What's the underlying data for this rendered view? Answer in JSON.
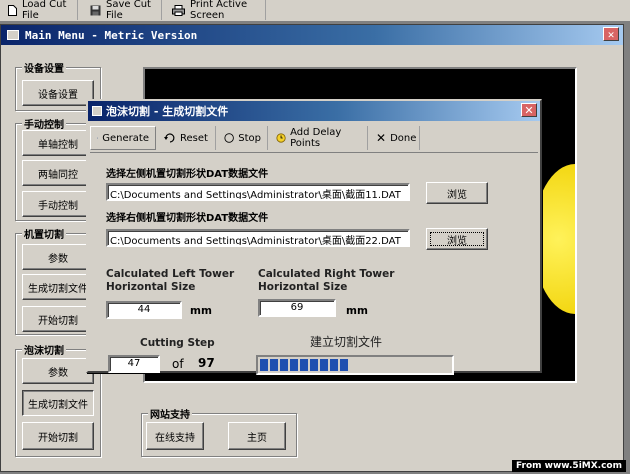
{
  "toolbar": {
    "load_cut_file": "Load Cut File",
    "save_cut_file": "Save Cut File",
    "print_active_screen": "Print Active Screen"
  },
  "main_window": {
    "title": "Main Menu -  Metric Version",
    "groups": {
      "device": {
        "title": "设备设置",
        "buttons": [
          "设备设置"
        ]
      },
      "manual": {
        "title": "手动控制",
        "buttons": [
          "单轴控制",
          "两轴同控",
          "手动控制"
        ]
      },
      "machine_cut": {
        "title": "机置切割",
        "buttons": [
          "参数",
          "生成切割文件",
          "开始切割"
        ]
      },
      "foam_cut": {
        "title": "泡沫切割",
        "buttons": [
          "参数",
          "生成切割文件",
          "开始切割"
        ]
      },
      "web_support": {
        "title": "网站支持",
        "buttons": [
          "在线支持",
          "主页"
        ]
      }
    }
  },
  "dialog": {
    "title": "泡沫切割 - 生成切割文件",
    "toolbar": {
      "generate": "Generate",
      "reset": "Reset",
      "stop": "Stop",
      "add_delay_points": "Add Delay Points",
      "done": "Done"
    },
    "left_file": {
      "label": "选择左侧机置切割形状DAT数据文件",
      "path": "C:\\Documents and Settings\\Administrator\\桌面\\截面11.DAT",
      "browse": "浏览"
    },
    "right_file": {
      "label": "选择右侧机置切割形状DAT数据文件",
      "path": "C:\\Documents and Settings\\Administrator\\桌面\\截面22.DAT",
      "browse": "浏览"
    },
    "left_tower": {
      "label": "Calculated Left Tower\nHorizontal Size",
      "value": "44",
      "unit": "mm"
    },
    "right_tower": {
      "label": "Calculated Right Tower\nHorizontal Size",
      "value": "69",
      "unit": "mm"
    },
    "cutting_step": {
      "label": "Cutting Step",
      "current": "47",
      "of_label": "of",
      "total": "97"
    },
    "progress": {
      "label": "建立切割文件",
      "fraction": 0.45,
      "color": "#1f4fb0"
    }
  },
  "watermark": "From www.5iMX.com"
}
